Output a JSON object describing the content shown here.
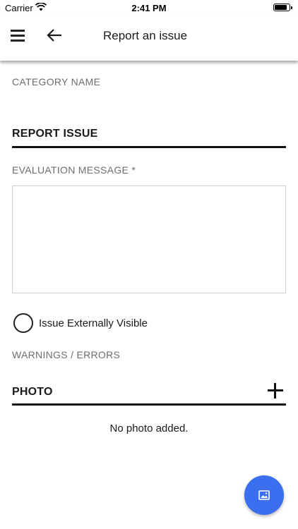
{
  "status_bar": {
    "carrier": "Carrier",
    "time": "2:41 PM",
    "battery_level": 0.85
  },
  "app_bar": {
    "title": "Report an issue",
    "menu_icon": "menu-icon",
    "back_icon": "arrow-left-icon"
  },
  "form": {
    "category_label": "CATEGORY NAME",
    "report_section_title": "REPORT ISSUE",
    "evaluation_label": "EVALUATION MESSAGE *",
    "evaluation_value": "",
    "externally_visible_label": "Issue Externally Visible",
    "externally_visible_checked": false,
    "warnings_label": "WARNINGS / ERRORS",
    "photo_section_title": "PHOTO",
    "no_photo_text": "No photo added."
  },
  "fab": {
    "icon": "image-icon",
    "color": "#3b6ff0"
  }
}
